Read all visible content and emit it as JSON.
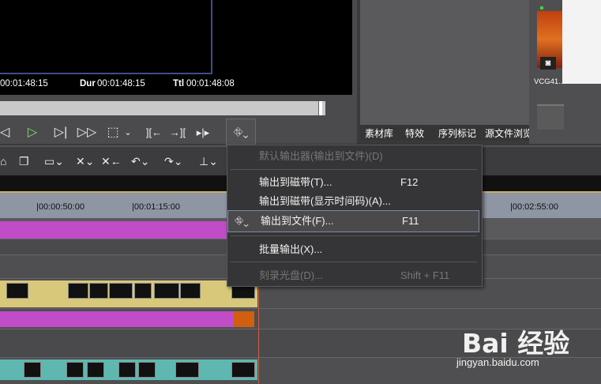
{
  "preview": {
    "timecode_in": "00:01:48:15",
    "dur_label": "Dur",
    "dur_value": "00:01:48:15",
    "ttl_label": "Ttl",
    "ttl_value": "00:01:48:08"
  },
  "asset_tabs": [
    "素材库",
    "特效",
    "序列标记",
    "源文件浏览"
  ],
  "asset_panel": {
    "clip_label": "VCG41..."
  },
  "ruler": {
    "ticks": [
      "|00:00:50:00",
      "|00:01:15:00",
      "|00:02:55:00"
    ]
  },
  "menu": {
    "items": [
      {
        "label": "默认输出器(输出到文件)(D)",
        "shortcut": "",
        "enabled": false
      },
      {
        "label": "输出到磁带(T)...",
        "shortcut": "F12",
        "enabled": true
      },
      {
        "label": "输出到磁带(显示时间码)(A)...",
        "shortcut": "",
        "enabled": true
      },
      {
        "label": "输出到文件(F)...",
        "shortcut": "F11",
        "enabled": true,
        "selected": true
      },
      {
        "label": "批量输出(X)...",
        "shortcut": "",
        "enabled": true
      },
      {
        "label": "刻录光盘(D)...",
        "shortcut": "Shift + F11",
        "enabled": false
      }
    ]
  },
  "watermark": {
    "logo": "Bai 经验",
    "url": "jingyan.baidu.com"
  },
  "colors": {
    "track_magenta": "#c04cc8",
    "track_teal": "#5fb8b0",
    "track_yellow": "#d8c87a",
    "accent_blue": "#3b4f8a"
  }
}
